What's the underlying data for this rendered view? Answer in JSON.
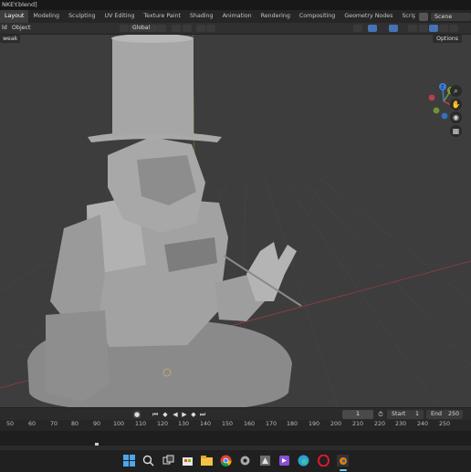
{
  "window": {
    "title": "NKEY.blend]"
  },
  "workspace_tabs": [
    {
      "label": "Layout",
      "active": true
    },
    {
      "label": "Modeling"
    },
    {
      "label": "Sculpting"
    },
    {
      "label": "UV Editing"
    },
    {
      "label": "Texture Paint"
    },
    {
      "label": "Shading"
    },
    {
      "label": "Animation"
    },
    {
      "label": "Rendering"
    },
    {
      "label": "Compositing"
    },
    {
      "label": "Geometry Nodes"
    },
    {
      "label": "Scripting"
    }
  ],
  "add_workspace": "+",
  "scene": {
    "name": "Scene"
  },
  "header": {
    "menu_add": "ld",
    "menu_object": "Object",
    "orientation": "Global"
  },
  "viewport_options": {
    "snap_mode": "weak",
    "options_label": "Options"
  },
  "gizmo": {
    "x": "X",
    "y": "Y",
    "z": "Z"
  },
  "timeline": {
    "current_frame": "1",
    "start_label": "Start",
    "start": "1",
    "end_label": "End",
    "end": "250",
    "ruler": [
      "50",
      "60",
      "70",
      "80",
      "90",
      "100",
      "110",
      "120",
      "130",
      "140",
      "150",
      "160",
      "170",
      "180",
      "190",
      "200",
      "210",
      "220",
      "230",
      "240",
      "250"
    ]
  },
  "colors": {
    "accent": "#4772b3",
    "x_axis": "#c2404f",
    "y_axis": "#7ea234",
    "z_axis": "#3f7fd6",
    "grid": "#454545",
    "header": "#303030",
    "active_tab": "#3d3d3d"
  },
  "icons": {
    "search": "search-icon",
    "windows": "windows-start-icon",
    "blender": "blender-icon"
  }
}
